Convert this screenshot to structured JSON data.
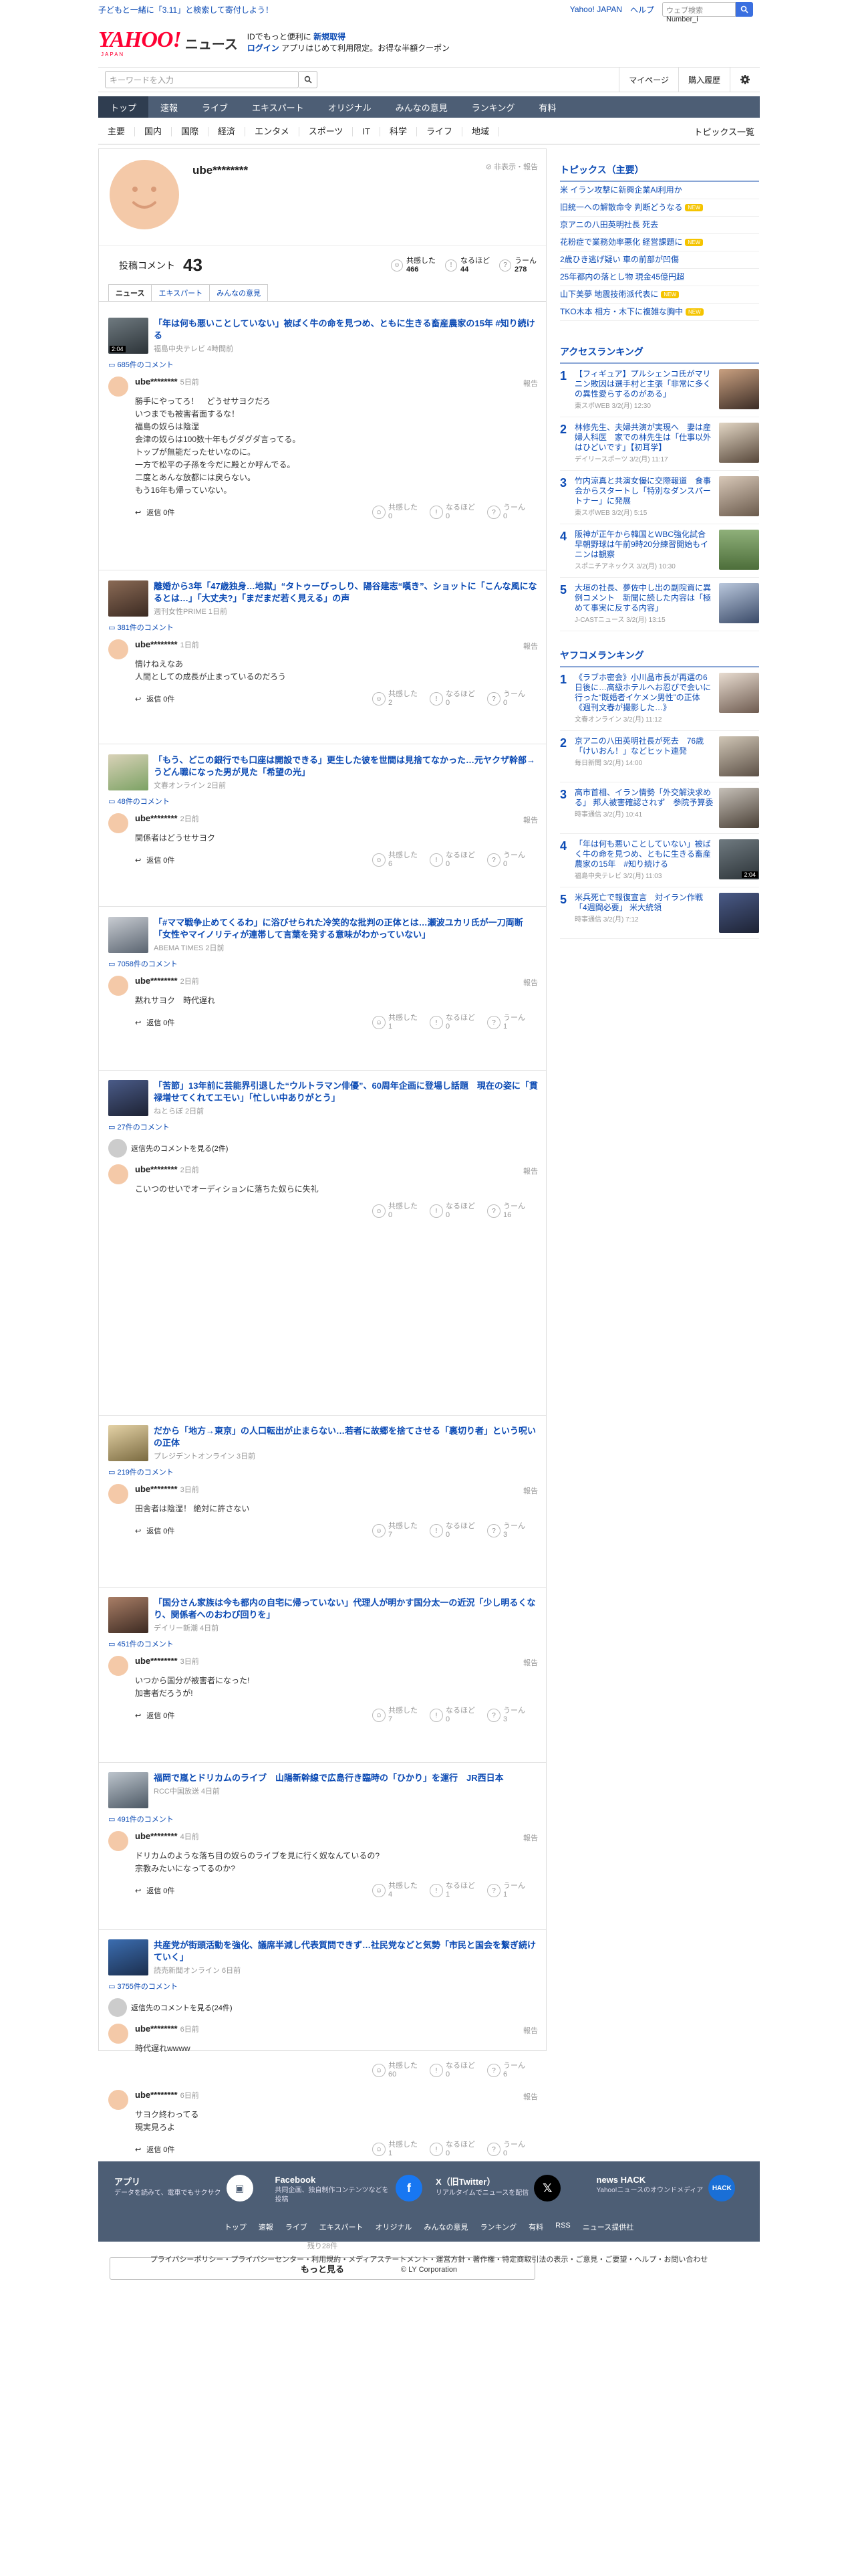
{
  "topbar": {
    "campaign": "子どもと一緒に「3.11」と検索して寄付しよう！",
    "links": [
      "Yahoo! JAPAN",
      "ヘルプ"
    ],
    "search_placeholder": "ウェブ検索",
    "search_value": "Number_i"
  },
  "header": {
    "logo": "YAHOO!",
    "logo_sub": "JAPAN",
    "section": "ニュース",
    "promo_line1": "IDでもっと便利に",
    "promo_signup": "新規取得",
    "promo_login": "ログイン",
    "promo_line2": "アプリはじめて利用限定。お得な半額クーポン"
  },
  "searchrow": {
    "placeholder": "キーワードを入力",
    "mypage": "マイページ",
    "history": "購入履歴"
  },
  "nav": {
    "items": [
      "トップ",
      "速報",
      "ライブ",
      "エキスパート",
      "オリジナル",
      "みんなの意見",
      "ランキング",
      "有料"
    ]
  },
  "subnav": {
    "items": [
      "主要",
      "国内",
      "国際",
      "経済",
      "エンタメ",
      "スポーツ",
      "IT",
      "科学",
      "ライフ",
      "地域"
    ],
    "all": "トピックス一覧"
  },
  "profile": {
    "name": "ube********",
    "hide": "非表示・報告",
    "post_label": "投稿コメント",
    "post_count": "43",
    "reactions": [
      {
        "label": "共感した",
        "count": "466"
      },
      {
        "label": "なるほど",
        "count": "44"
      },
      {
        "label": "うーん",
        "count": "278"
      }
    ],
    "tabs": [
      "ニュース",
      "エキスパート",
      "みんなの意見"
    ]
  },
  "colors": {
    "accent": "#0b4ab4",
    "nav": "#4d5e75",
    "logo": "#ff0033"
  },
  "articles": [
    {
      "title": "「年は何も悪いことしていない」被ばく牛の命を見つめ、ともに生きる畜産農家の15年 #知り続ける",
      "meta": "福島中央テレビ 4時間前",
      "count": "685件のコメント",
      "badge": "2:04",
      "author": "ube********",
      "time": "5日前",
      "body": "勝手にやってろ！　どうせサヨクだろ\nいつまでも被害者面するな！\n福島の奴らは陰湿\n会津の奴らは100数十年もグダグダ言ってる。\nトップが無能だったせいなのに。\n一方で松平の子孫を今だに殿とか呼んでる。\n二度とあんな放都には戻らない。\nもう16年も帰っていない。",
      "reply": "返信 0件",
      "r": [
        "0",
        "0",
        "0"
      ]
    },
    {
      "title": "離婚から3年「47歳独身…地獄」“タトゥーびっしり、陽谷建志“嘆き”、ショットに「こんな風になるとは…」「大丈夫?」「まだまだ若く見える」の声",
      "meta": "週刊女性PRIME 1日前",
      "count": "381件のコメント",
      "author": "ube********",
      "time": "1日前",
      "body": "情けねえなあ\n人間としての成長が止まっているのだろう",
      "reply": "返信 0件",
      "r": [
        "2",
        "0",
        "0"
      ]
    },
    {
      "title": "「もう、どこの銀行でも口座は開設できる」更生した彼を世間は見捨てなかった…元ヤクザ幹部→うどん職になった男が見た「希望の光」",
      "meta": "文春オンライン 2日前",
      "count": "48件のコメント",
      "author": "ube********",
      "time": "2日前",
      "body": "関係者はどうせサヨク",
      "reply": "返信 0件",
      "r": [
        "6",
        "0",
        "0"
      ]
    },
    {
      "title": "「#ママ戦争止めてくるわ」に浴びせられた冷笑的な批判の正体とは…瀬波ユカリ氏が一刀両断「女性やマイノリティが連帯して言葉を発する意味がわかっていない」",
      "meta": "ABEMA TIMES 2日前",
      "count": "7058件のコメント",
      "author": "ube********",
      "time": "2日前",
      "body": "黙れサヨク　時代遅れ",
      "reply": "返信 0件",
      "r": [
        "1",
        "0",
        "1"
      ]
    },
    {
      "title": "「苦節」13年前に芸能界引退した“ウルトラマン俳優”、60周年企画に登場し話題　現在の姿に「貫禄増せてくれてエモい」「忙しい中ありがとう」",
      "meta": "ねとらぼ 2日前",
      "count": "27件のコメント",
      "chain": "返信先のコメントを見る(2件)",
      "author": "ube********",
      "time": "2日前",
      "body": "こいつのせいでオーディションに落ちた奴らに失礼",
      "reply": "",
      "r": [
        "0",
        "0",
        "16"
      ]
    },
    {
      "title": "だから「地方→東京」の人口転出が止まらない…若者に故郷を捨てさせる「裏切り者」という呪いの正体",
      "meta": "プレジデントオンライン 3日前",
      "count": "219件のコメント",
      "author": "ube********",
      "time": "3日前",
      "body": "田舎者は陰湿！ 絶対に許さない",
      "reply": "返信 0件",
      "r": [
        "7",
        "0",
        "3"
      ]
    },
    {
      "title": "「国分さん家族は今も都内の自宅に帰っていない」代理人が明かす国分太一の近況「少し明るくなり、関係者へのおわび回りを」",
      "meta": "デイリー新潮 4日前",
      "count": "451件のコメント",
      "author": "ube********",
      "time": "3日前",
      "body": "いつから国分が被害者になった!\n加害者だろうが!",
      "reply": "返信 0件",
      "r": [
        "7",
        "0",
        "3"
      ]
    },
    {
      "title": "福岡で嵐とドリカムのライブ　山陽新幹線で広島行き臨時の「ひかり」を運行　JR西日本",
      "meta": "RCC中国放送 4日前",
      "count": "491件のコメント",
      "author": "ube********",
      "time": "4日前",
      "body": "ドリカムのような落ち目の奴らのライブを見に行く奴なんているの?\n宗教みたいになってるのか?",
      "reply": "返信 0件",
      "r": [
        "4",
        "1",
        "1"
      ]
    },
    {
      "title": "共産党が街頭活動を強化、議席半減し代表質問できず…社民党などと気勢「市民と国会を繋ぎ続けていく」",
      "meta": "読売新聞オンライン 6日前",
      "count": "3755件のコメント",
      "chain": "返信先のコメントを見る(24件)",
      "author": "ube********",
      "time": "6日前",
      "body": "時代遅れwwww",
      "reply": "",
      "r": [
        "60",
        "0",
        "6"
      ],
      "author2": "ube********",
      "time2": "6日前",
      "body2": "サヨク終わってる\n現実見ろよ",
      "reply2": "返信 0件",
      "r2": [
        "1",
        "0",
        "0"
      ]
    }
  ],
  "react_labels": [
    "共感した",
    "なるほど",
    "うーん"
  ],
  "report": "報告",
  "remaining": "残り28件",
  "more": "もっと見る",
  "side": {
    "topics_title": "トピックス（主要）",
    "topics": [
      {
        "t": "米 イラン攻撃に新興企業AI利用か",
        "b": ""
      },
      {
        "t": "旧統一への解散命令 判断どうなる",
        "b": "NEW"
      },
      {
        "t": "京アニの八田英明社長 死去",
        "b": ""
      },
      {
        "t": "花粉症で業務効率悪化 経営課題に",
        "b": "NEW"
      },
      {
        "t": "2歳ひき逃げ疑い 車の前部が凹傷",
        "b": ""
      },
      {
        "t": "25年都内の落とし物 現金45億円超",
        "b": ""
      },
      {
        "t": "山下美夢 地震技術派代表に",
        "b": "NEW"
      },
      {
        "t": "TKO木本 相方・木下に複雑な胸中",
        "b": "NEW"
      }
    ],
    "access_title": "アクセスランキング",
    "access": [
      {
        "t": "【フィギュア】プルシェンコ氏がマリニン敗因は選手村と主張「非常に多くの異性愛らするのがある」",
        "m": "東スポWEB 3/2(月) 12:30"
      },
      {
        "t": "林修先生、夫婦共演が実現へ　妻は産婦人科医　家での林先生は「仕事以外はひどいです」【初耳学】",
        "m": "デイリースポーツ 3/2(月) 11:17"
      },
      {
        "t": "竹内涼真と共演女優に交際報道　食事会からスタートし「特別なダンスパートナー」に発展",
        "m": "東スポWEB 3/2(月) 5:15"
      },
      {
        "t": "阪神が正午から韓国とWBC強化試合　早朝野球は午前9時20分練習開始もイニンは観察",
        "m": "スポニチアネックス 3/2(月) 10:30"
      },
      {
        "t": "大垣の社長、夢佐中し出の副院資に異例コメント　新聞に読した内容は「極めて事実に反する内容」",
        "m": "J-CASTニュース 3/2(月) 13:15"
      }
    ],
    "yafoo_title": "ヤフコメランキング",
    "yafoo": [
      {
        "t": "《ラブホ密会》小川晶市長が再選の6日後に…高級ホテルへお忍びで会いに行った“既婚者イケメン男性”の正体《週刊文春が撮影した…》",
        "m": "文春オンライン 3/2(月) 11:12"
      },
      {
        "t": "京アニの八田英明社長が死去　76歳「けいおん！」などヒット連発",
        "m": "毎日新聞 3/2(月) 14:00"
      },
      {
        "t": "高市首相、イラン情勢「外交解決求める」 邦人被害確認されず　参院予算委",
        "m": "時事通信 3/2(月) 10:41"
      },
      {
        "t": "「年は何も悪いことしていない」被ばく牛の命を見つめ、ともに生きる畜産農家の15年　#知り続ける",
        "m": "福島中央テレビ 3/2(月) 11:03"
      },
      {
        "t": "米兵死亡で報復宣言　対イラン作戦「4週間必要」 米大統領",
        "m": "時事通信 3/2(月) 7:12"
      }
    ],
    "thumb_badge": "2:04"
  },
  "footer": {
    "cards": [
      {
        "t": "アプリ",
        "d": "データを読みて、電車でもサクサク"
      },
      {
        "t": "Facebook",
        "d": "共同企画、独自制作コンテンツなどを投稿"
      },
      {
        "t": "X（旧Twitter）",
        "d": "リアルタイムでニュースを配信"
      },
      {
        "t": "news HACK",
        "d": "Yahoo!ニュースのオウンドメディア"
      }
    ],
    "links": [
      "トップ",
      "速報",
      "ライブ",
      "エキスパート",
      "オリジナル",
      "みんなの意見",
      "ランキング",
      "有料",
      "RSS",
      "ニュース提供社"
    ],
    "legal": "プライバシーポリシー・プライバシーセンター・利用規約・メディアステートメント・運営方針・著作権・特定商取引法の表示・ご意見・ご要望・ヘルプ・お問い合わせ",
    "copyright": "© LY Corporation"
  }
}
